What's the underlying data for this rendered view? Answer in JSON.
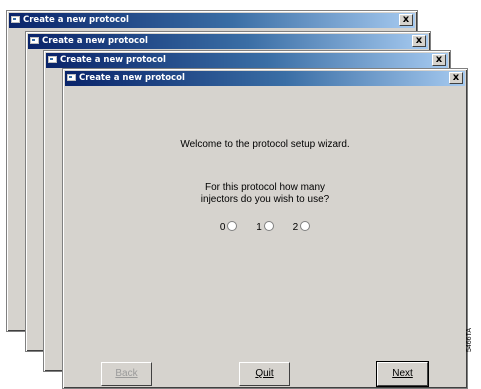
{
  "windows": [
    {
      "title": "Create a new protocol",
      "close_label": "x"
    },
    {
      "title": "Create a new protocol",
      "close_label": "x"
    },
    {
      "title": "Create a new protocol",
      "close_label": "x"
    },
    {
      "title": "Create a new protocol",
      "close_label": "x"
    }
  ],
  "wizard": {
    "welcome": "Welcome to the protocol setup wizard.",
    "question_line1": "For this protocol how many",
    "question_line2": "injectors do you wish to use?",
    "options": [
      {
        "label": "0",
        "selected": false
      },
      {
        "label": "1",
        "selected": false
      },
      {
        "label": "2",
        "selected": false
      }
    ],
    "buttons": {
      "back": {
        "label": "Back",
        "enabled": false
      },
      "quit": {
        "label": "Quit",
        "enabled": true
      },
      "next": {
        "label": "Next",
        "enabled": true,
        "default": true
      }
    }
  },
  "figure_code": "5466TA",
  "colors": {
    "window_bg": "#d6d3ce",
    "titlebar_start": "#0a246a",
    "titlebar_end": "#a6caf0"
  }
}
